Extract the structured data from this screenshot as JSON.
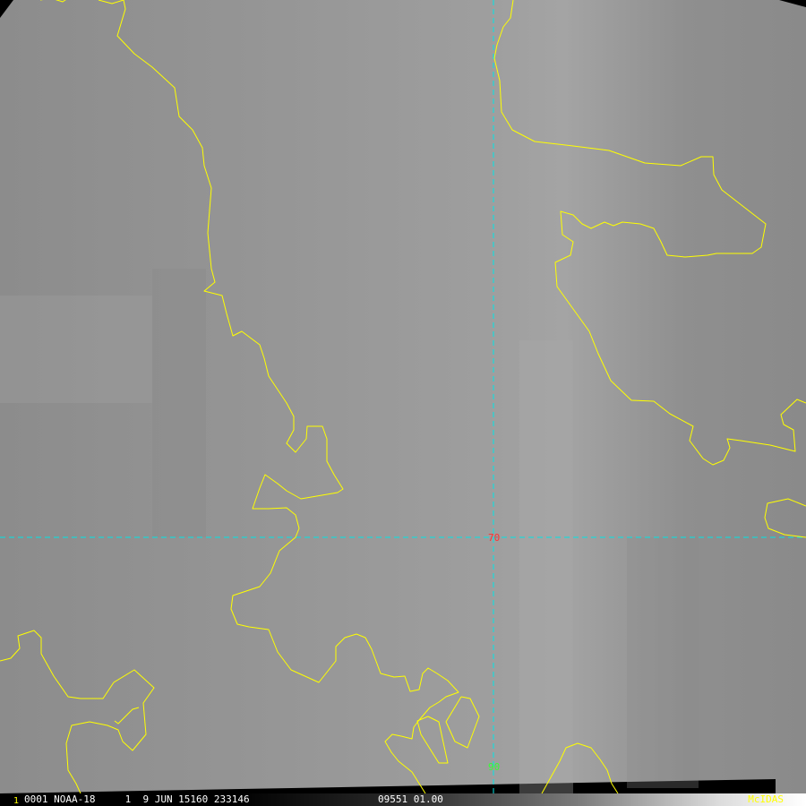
{
  "map": {
    "background": "#9a9a9a",
    "coastline_color": "#ffff00",
    "grid_color": "#00e5e5",
    "latitude_label": "70",
    "longitude_label": "90",
    "latitude_label_color": "#ff3030",
    "longitude_label_color": "#33ff33"
  },
  "status_bar": {
    "frame": "1",
    "satellite_info": "0001 NOAA-18     1  9 JUN 15160 233146",
    "band_info": "09551 01.00",
    "brand": "McIDAS"
  }
}
